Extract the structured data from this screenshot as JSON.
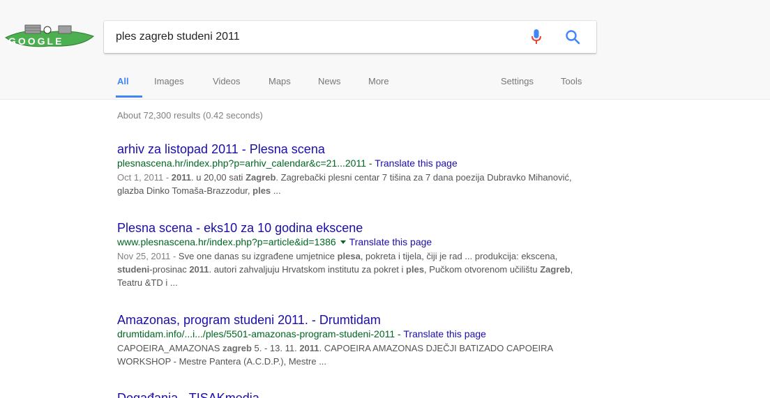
{
  "search": {
    "query": "ples zagreb studeni 2011",
    "doodle_text": "GOOGLE"
  },
  "tabs": [
    {
      "label": "All",
      "active": true
    },
    {
      "label": "Images"
    },
    {
      "label": "Videos"
    },
    {
      "label": "Maps"
    },
    {
      "label": "News"
    },
    {
      "label": "More"
    },
    {
      "label": "Settings"
    },
    {
      "label": "Tools"
    }
  ],
  "stats": "About 72,300 results (0.42 seconds)",
  "results": [
    {
      "title": "arhiv za listopad 2011 - Plesna scena",
      "url": "plesnascena.hr/index.php?p=arhiv_calendar&c=21...2011",
      "sep": " - ",
      "translate": "Translate this page",
      "date": "Oct 1, 2011 - ",
      "s1_b1": "2011",
      "s1_t1": ". u 20,00 sati ",
      "s1_b2": "Zagreb",
      "s1_t2": ". Zagrebački plesni centar 7 tišina za 7 dana poezija Dubravko Mihanović, glazba Dinko Tomaša-Brazzodur, ",
      "s1_b3": "ples",
      "s1_t3": " ..."
    },
    {
      "title": "Plesna scena - eks10 za 10 godina ekscene",
      "url": "www.plesnascena.hr/index.php?p=article&id=1386",
      "translate": "Translate this page",
      "date": "Nov 25, 2011 - ",
      "s_t1": "Sve one danas su izgrađene umjetnice ",
      "s_b1": "plesa",
      "s_t2": ", pokreta i tijela, čiji je rad ... produkcija: ekscena, ",
      "s_b2": "studeni",
      "s_t3": "-prosinac ",
      "s_b3": "2011",
      "s_t4": ". autori zahvaljuju Hrvatskom institutu za pokret i ",
      "s_b4": "ples",
      "s_t5": ", Pučkom otvorenom učilištu ",
      "s_b5": "Zagreb",
      "s_t6": ", Teatru &TD i ..."
    },
    {
      "title": "Amazonas, program studeni 2011. - Drumtidam",
      "url": "drumtidam.info/...i.../ples/5501-amazonas-program-studeni-2011",
      "sep": " - ",
      "translate": "Translate this page",
      "s_t1": "CAPOEIRA_AMAZONAS ",
      "s_b1": "zagreb",
      "s_t2": " 5. - 13. 11. ",
      "s_b2": "2011",
      "s_t3": ". CAPOEIRA AMAZONAS DJEČJI BATIZADO CAPOEIRA WORKSHOP - Mestre Pantera (A.C.D.P.), Mestre ..."
    }
  ],
  "cut_title": "Događanja - TISAKmedia",
  "colors": {
    "link": "#1a0dab",
    "url": "#006621",
    "snippet": "#545454",
    "accent": "#4285f4"
  }
}
